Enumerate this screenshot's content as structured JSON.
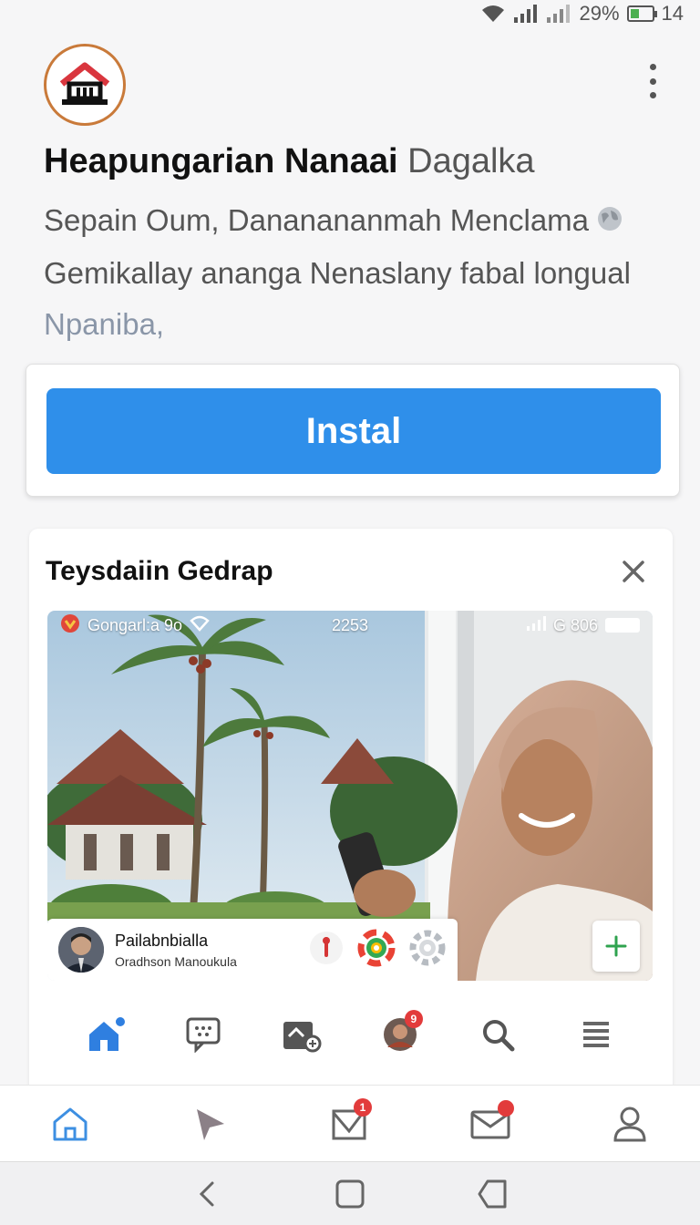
{
  "status_bar": {
    "battery_percent": "29%",
    "time": "14"
  },
  "app": {
    "title": "Heapungarian Nanaai",
    "title_suffix": "Dagalka",
    "desc_line1": "Sepain Oum, Dananananmah Menclama",
    "desc_line2": "Gemikallay ananga Nenaslany fabal longual",
    "desc_line3": "Npaniba,"
  },
  "install": {
    "label": "Instal"
  },
  "feature": {
    "title": "Teysdaiin Gedrap",
    "media_status_left": "Gongarl:a 9o",
    "media_status_center": "2253",
    "media_status_right": "G 806",
    "post_name": "Pailabnbialla",
    "post_sub": "Oradhson Manoukula"
  },
  "badges": {
    "inner_avatar": "9",
    "bottom_compose": "1"
  },
  "colors": {
    "primary": "#2f8fea",
    "badge": "#e23b3b",
    "logo_ring": "#c97a3a"
  }
}
